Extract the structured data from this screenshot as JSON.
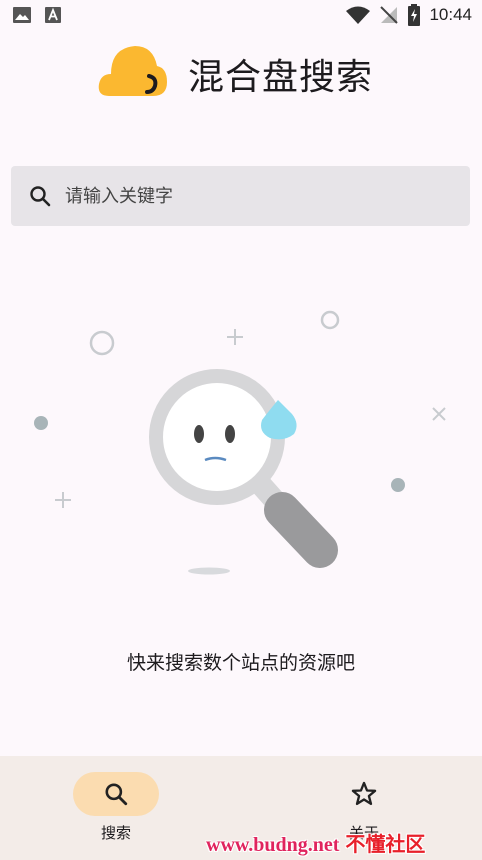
{
  "status_bar": {
    "time": "10:44",
    "left_icons": [
      "image-icon",
      "text-a-icon"
    ],
    "right_icons": [
      "wifi-icon",
      "no-signal-icon",
      "battery-charging-icon"
    ]
  },
  "header": {
    "title": "混合盘搜索",
    "logo_icon": "cloud-logo-icon"
  },
  "search": {
    "placeholder": "请输入关键字",
    "icon": "search-icon"
  },
  "empty_state": {
    "illustration": "sad-magnifier-icon",
    "message": "快来搜索数个站点的资源吧"
  },
  "bottom_nav": {
    "items": [
      {
        "label": "搜索",
        "icon": "search-icon",
        "active": true
      },
      {
        "label": "关于",
        "icon": "star-icon",
        "active": false
      }
    ]
  },
  "watermark": {
    "url": "www.budng.net",
    "site": "不懂社区"
  },
  "colors": {
    "background": "#fdf8fc",
    "accent": "#fbb830",
    "nav_active_pill": "#fbdcb0",
    "search_bg": "#e7e4e8",
    "bottom_nav_bg": "#f3ece8",
    "watermark": "#e0245e"
  }
}
